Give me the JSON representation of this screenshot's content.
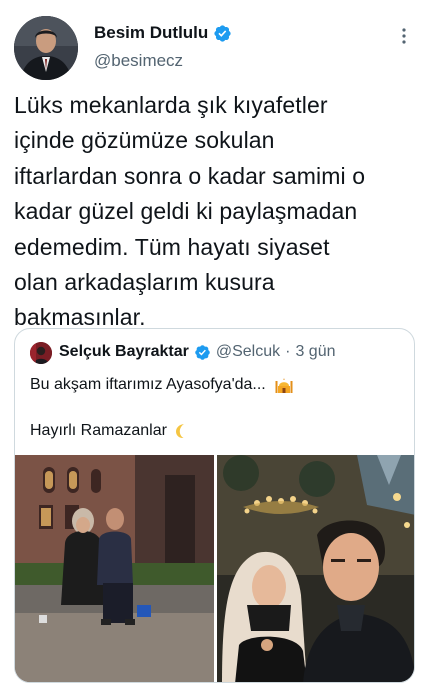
{
  "tweet": {
    "author_name": "Besim Dutlulu",
    "author_handle": "@besimecz",
    "text": "Lüks mekanlarda şık kıyafetler\niçinde gözümüze sokulan\niftarlardan sonra o kadar samimi o\nkadar güzel geldi ki paylaşmadan\nedemedim. Tüm hayatı siyaset\nolan arkadaşlarım kusura\nbakmasınlar."
  },
  "quote": {
    "author_name": "Selçuk Bayraktar",
    "author_handle": "@Selcuk",
    "separator": "·",
    "time": "3 gün",
    "line1": "Bu akşam iftarımız Ayasofya'da...",
    "line2": "Hayırlı Ramazanlar"
  },
  "colors": {
    "verified": "#1d9bf0",
    "text": "#0f1419",
    "secondary": "#536471",
    "border": "#cfd9de"
  },
  "icons": {
    "verified": "verified-badge-icon",
    "more": "more-dots-icon",
    "mosque": "mosque-emoji-icon",
    "moon": "crescent-moon-emoji-icon"
  }
}
